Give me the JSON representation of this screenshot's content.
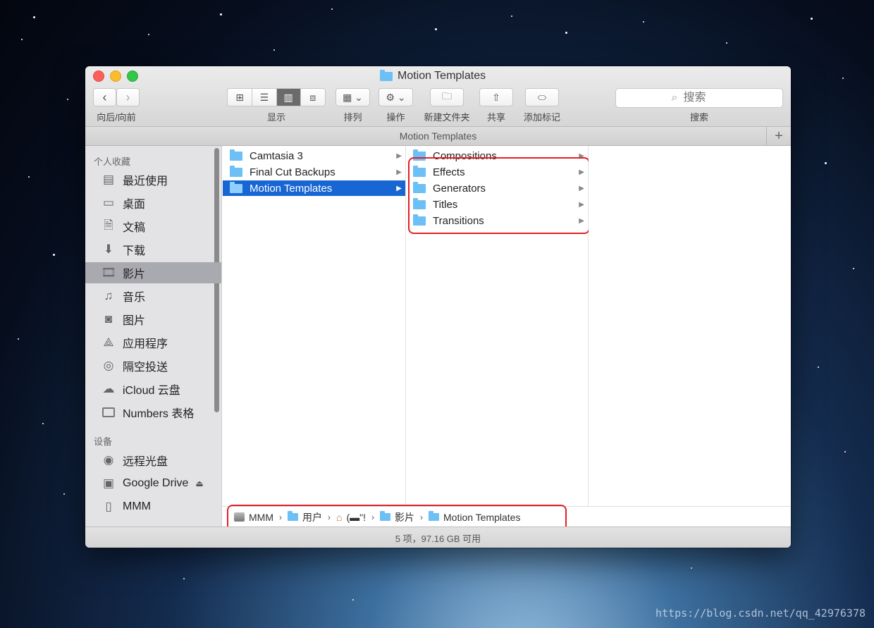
{
  "window": {
    "title": "Motion Templates"
  },
  "toolbar": {
    "nav_label": "向后/向前",
    "view_label": "显示",
    "arrange_label": "排列",
    "action_label": "操作",
    "new_folder_label": "新建文件夹",
    "share_label": "共享",
    "tag_label": "添加标记",
    "search_placeholder": "搜索",
    "search_label": "搜索",
    "active_view": "columns"
  },
  "path_header": "Motion Templates",
  "sidebar": {
    "favorites_heading": "个人收藏",
    "favorites": [
      {
        "label": "最近使用",
        "icon": "recents-icon"
      },
      {
        "label": "桌面",
        "icon": "desktop-icon"
      },
      {
        "label": "文稿",
        "icon": "documents-icon"
      },
      {
        "label": "下载",
        "icon": "downloads-icon"
      },
      {
        "label": "影片",
        "icon": "movies-icon",
        "active": true
      },
      {
        "label": "音乐",
        "icon": "music-icon"
      },
      {
        "label": "图片",
        "icon": "pictures-icon"
      },
      {
        "label": "应用程序",
        "icon": "applications-icon"
      },
      {
        "label": "隔空投送",
        "icon": "airdrop-icon"
      },
      {
        "label": "iCloud 云盘",
        "icon": "cloud-icon"
      },
      {
        "label": "Numbers 表格",
        "icon": "folder-icon"
      }
    ],
    "devices_heading": "设备",
    "devices": [
      {
        "label": "远程光盘",
        "icon": "disc-icon"
      },
      {
        "label": "Google Drive",
        "icon": "drive-icon"
      },
      {
        "label": "MMM",
        "icon": "disk-icon"
      }
    ]
  },
  "columns": {
    "col1": [
      {
        "name": "Camtasia 3"
      },
      {
        "name": "Final Cut Backups"
      },
      {
        "name": "Motion Templates",
        "selected": true
      }
    ],
    "col2": [
      {
        "name": "Compositions"
      },
      {
        "name": "Effects"
      },
      {
        "name": "Generators"
      },
      {
        "name": "Titles"
      },
      {
        "name": "Transitions"
      }
    ]
  },
  "path_footer": [
    {
      "label": "MMM",
      "icon": "disk-icon"
    },
    {
      "label": "用户",
      "icon": "folder-icon"
    },
    {
      "label": "(▬\"!",
      "icon": "home-icon"
    },
    {
      "label": "影片",
      "icon": "folder-icon"
    },
    {
      "label": "Motion Templates",
      "icon": "folder-icon"
    }
  ],
  "status": "5 项，97.16 GB 可用",
  "watermark": "https://blog.csdn.net/qq_42976378",
  "colors": {
    "selection": "#1766d3",
    "highlight_box": "#e41f26",
    "folder": "#6cc0f5"
  }
}
